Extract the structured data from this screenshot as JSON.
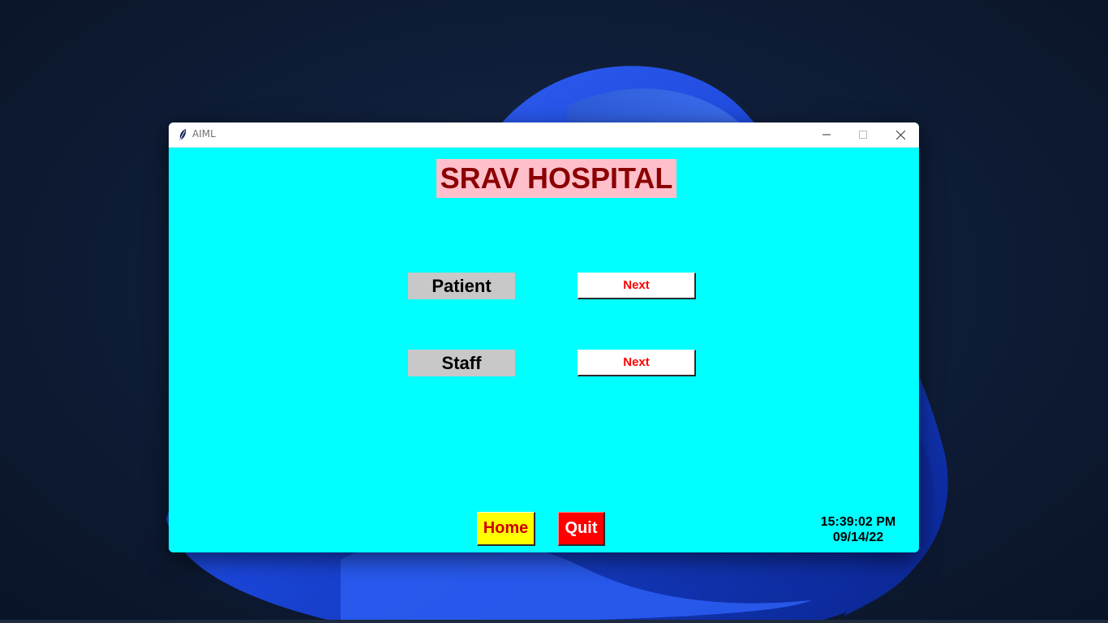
{
  "window": {
    "title": "AIML",
    "background": "#00ffff",
    "icon": "feather-icon",
    "controls": {
      "minimize_icon": "minimize-icon",
      "maximize_icon": "maximize-icon",
      "close_icon": "close-icon"
    }
  },
  "main": {
    "heading": "SRAV HOSPITAL",
    "heading_colors": {
      "text": "#8b0000",
      "background": "#ffc0cb"
    },
    "rows": [
      {
        "label": "Patient",
        "button": "Next"
      },
      {
        "label": "Staff",
        "button": "Next"
      }
    ]
  },
  "footer": {
    "home_label": "Home",
    "quit_label": "Quit",
    "time": "15:39:02 PM",
    "date": "09/14/22"
  },
  "colors": {
    "home_bg": "#ffff00",
    "home_text": "#cc0000",
    "quit_bg": "#ff0000",
    "quit_text": "#ffffff",
    "next_text": "#ff0000",
    "label_bg": "#c8c8c8"
  }
}
